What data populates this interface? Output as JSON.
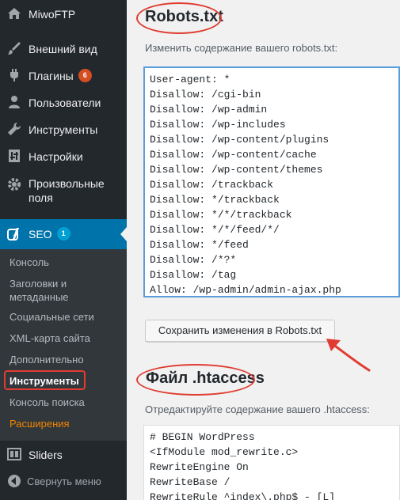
{
  "sidebar": {
    "site": "MiwoFTP",
    "items": [
      {
        "label": "Внешний вид",
        "icon": "paintbrush-icon"
      },
      {
        "label": "Плагины",
        "icon": "plugin-icon",
        "badge": "6"
      },
      {
        "label": "Пользователи",
        "icon": "users-icon"
      },
      {
        "label": "Инструменты",
        "icon": "wrench-icon"
      },
      {
        "label": "Настройки",
        "icon": "settings-icon"
      },
      {
        "label": "Произвольные",
        "label2": "поля",
        "icon": "gear-icon"
      }
    ],
    "seo": {
      "label": "SEO",
      "badge": "1",
      "icon": "yoast-icon"
    },
    "submenu": [
      {
        "label": "Консоль"
      },
      {
        "label": "Заголовки и",
        "label2": "метаданные"
      },
      {
        "label": "Социальные сети"
      },
      {
        "label": "XML-карта сайта"
      },
      {
        "label": "Дополнительно"
      },
      {
        "label": "Инструменты"
      },
      {
        "label": "Консоль поиска"
      },
      {
        "label": "Расширения"
      }
    ],
    "sliders": {
      "label": "Sliders",
      "icon": "sliders-icon"
    },
    "collapse": {
      "label": "Свернуть меню",
      "icon": "collapse-icon"
    }
  },
  "robots": {
    "title": "Robots.txt",
    "description": "Изменить содержание вашего robots.txt:",
    "lines": [
      "User-agent: *",
      "Disallow: /cgi-bin",
      "Disallow: /wp-admin",
      "Disallow: /wp-includes",
      "Disallow: /wp-content/plugins",
      "Disallow: /wp-content/cache",
      "Disallow: /wp-content/themes",
      "Disallow: /trackback",
      "Disallow: */trackback",
      "Disallow: */*/trackback",
      "Disallow: */*/feed/*/",
      "Disallow: */feed",
      "Disallow: /*?*",
      "Disallow: /tag",
      "Allow: /wp-admin/admin-ajax.php"
    ],
    "save_label": "Сохранить изменения в Robots.txt"
  },
  "htaccess": {
    "title": "Файл .htaccess",
    "description": "Отредактируйте содержание вашего .htaccess:",
    "lines": [
      "# BEGIN WordPress",
      "<IfModule mod_rewrite.c>",
      "RewriteEngine On",
      "RewriteBase /",
      "RewriteRule ^index\\.php$ - [L]"
    ]
  },
  "colors": {
    "accent": "#0073aa",
    "annotation": "#e03c31",
    "sidebar": "#23282d"
  }
}
